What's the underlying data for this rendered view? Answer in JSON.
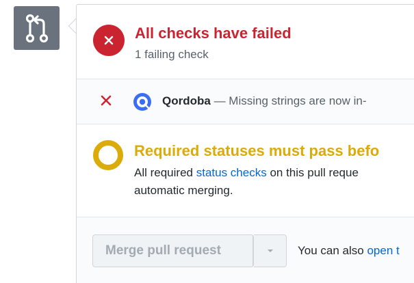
{
  "status": {
    "title": "All checks have failed",
    "subtitle": "1 failing check",
    "color": "#cb2431"
  },
  "checks": [
    {
      "name": "Qordoba",
      "description": " — Missing strings are now in-",
      "state": "failure",
      "icon": "qordoba-logo"
    }
  ],
  "required": {
    "title": "Required statuses must pass befo",
    "body_prefix": "All required ",
    "body_link": "status checks",
    "body_suffix": " on this pull reque",
    "body_line2": "automatic merging.",
    "color": "#dbab09"
  },
  "merge": {
    "button_label": "Merge pull request",
    "also_prefix": "You can also ",
    "also_link": "open t"
  },
  "colors": {
    "failure": "#cb2431",
    "pending": "#dbab09",
    "link": "#0366d6"
  }
}
